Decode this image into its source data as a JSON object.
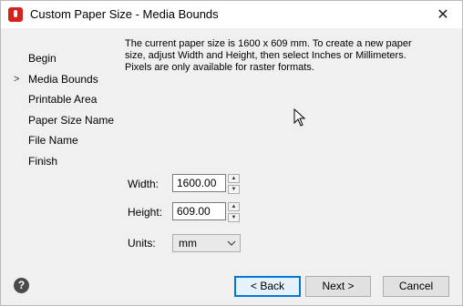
{
  "window": {
    "title": "Custom Paper Size - Media Bounds",
    "close_glyph": "✕"
  },
  "steps": {
    "active_marker": ">",
    "items": [
      {
        "label": "Begin"
      },
      {
        "label": "Media Bounds",
        "active": true
      },
      {
        "label": "Printable Area"
      },
      {
        "label": "Paper Size Name"
      },
      {
        "label": "File Name"
      },
      {
        "label": "Finish"
      }
    ]
  },
  "description": "The current paper size is 1600 x 609 mm. To create a new paper size, adjust Width and Height, then select Inches or Millimeters. Pixels are only available for raster formats.",
  "fields": {
    "width": {
      "label": "Width:",
      "value": "1600.00"
    },
    "height": {
      "label": "Height:",
      "value": "609.00"
    },
    "units": {
      "label": "Units:",
      "value": "mm"
    }
  },
  "buttons": {
    "back": "< Back",
    "next": "Next >",
    "cancel": "Cancel",
    "help": "?"
  },
  "colors": {
    "accent": "#0078d7",
    "app_icon": "#d9211b"
  }
}
